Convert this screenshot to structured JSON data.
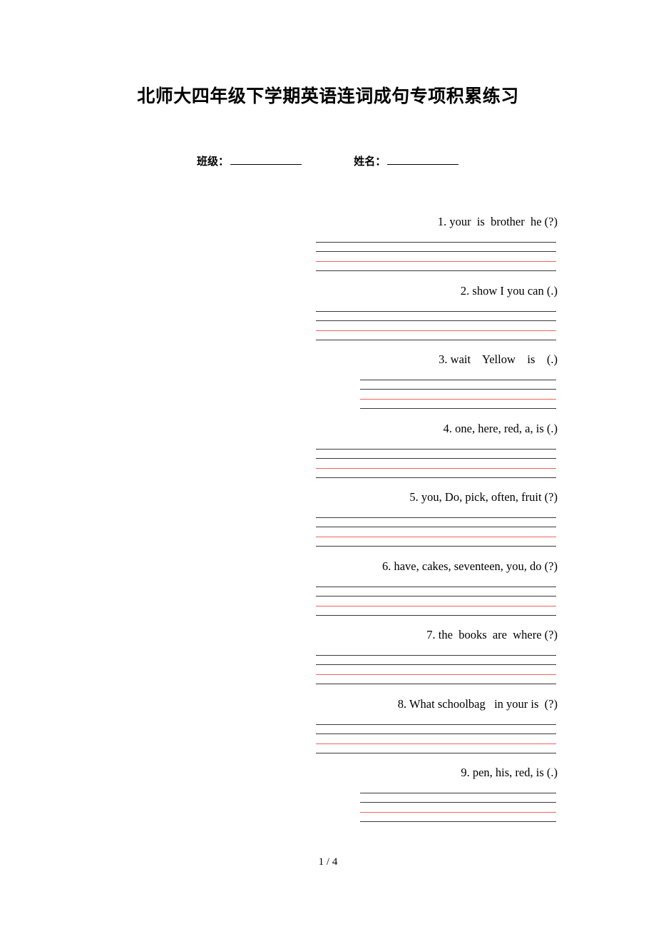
{
  "document": {
    "title": "北师大四年级下学期英语连词成句专项积累练习",
    "footer": "1 / 4"
  },
  "id_row": {
    "class_label": "班级：",
    "name_label": "姓名："
  },
  "questions": [
    {
      "text": "1. your  is  brother  he (?)",
      "width": "wide"
    },
    {
      "text": "2. show I you can (.)",
      "width": "wide"
    },
    {
      "text": "3. wait    Yellow    is    (.)",
      "width": "narrow"
    },
    {
      "text": "4. one, here, red, a, is (.)",
      "width": "wide"
    },
    {
      "text": "5. you, Do, pick, often, fruit (?)",
      "width": "wide"
    },
    {
      "text": "6. have, cakes, seventeen, you, do (?)",
      "width": "wide"
    },
    {
      "text": "7. the  books  are  where (?)",
      "width": "wide"
    },
    {
      "text": "8. What schoolbag   in your is  (?)",
      "width": "wide"
    },
    {
      "text": "9. pen, his, red, is (.)",
      "width": "narrow"
    }
  ],
  "colors": {
    "guide_black": "#3a3a3a",
    "guide_red": "#f4625c",
    "text": "#000000",
    "page_background": "#ffffff"
  }
}
